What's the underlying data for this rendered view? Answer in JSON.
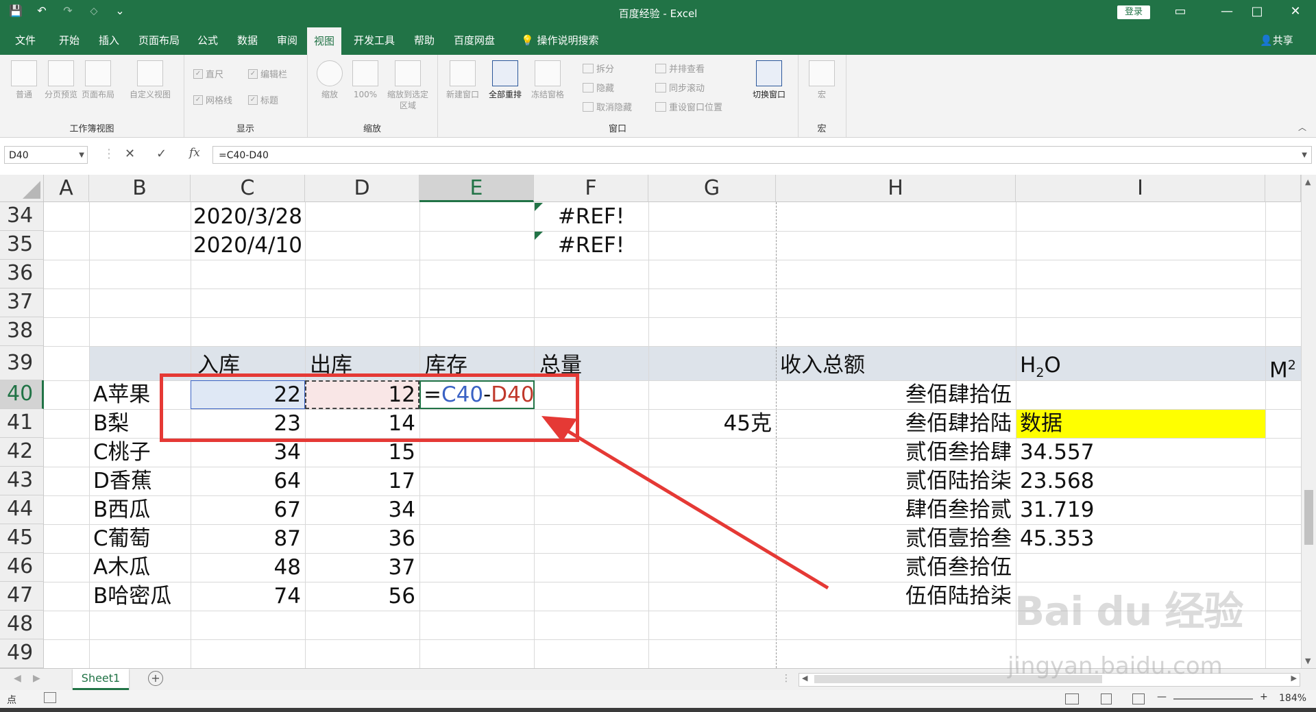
{
  "window": {
    "title": "百度经验  -  Excel",
    "login": "登录",
    "controls": [
      "▭",
      "—",
      "□",
      "✕"
    ]
  },
  "qat": [
    "💾",
    "↶",
    "↷",
    "⬦",
    "⌄"
  ],
  "menu": {
    "tabs": [
      "文件",
      "开始",
      "插入",
      "页面布局",
      "公式",
      "数据",
      "审阅",
      "视图",
      "开发工具",
      "帮助",
      "百度网盘",
      "操作说明搜索"
    ],
    "active": "视图",
    "share": "共享"
  },
  "ribbon": {
    "workbook_views": {
      "label": "工作簿视图",
      "buttons": [
        "普通",
        "分页预览",
        "页面布局",
        "自定义视图"
      ]
    },
    "show": {
      "label": "显示",
      "checks": [
        "直尺",
        "编辑栏",
        "网格线",
        "标题"
      ]
    },
    "zoom": {
      "label": "缩放",
      "buttons": [
        "缩放",
        "100%",
        "缩放到选定区域"
      ]
    },
    "window": {
      "label": "窗口",
      "buttons": [
        "新建窗口",
        "全部重排",
        "冻结窗格"
      ],
      "small": [
        "拆分",
        "隐藏",
        "取消隐藏",
        "并排查看",
        "同步滚动",
        "重设窗口位置"
      ],
      "switch": "切换窗口"
    },
    "macro": {
      "label": "宏",
      "button": "宏"
    }
  },
  "formula_bar": {
    "name_box": "D40",
    "cancel": "✕",
    "enter": "✓",
    "fx": "fx",
    "formula": "=C40-D40"
  },
  "grid": {
    "columns": [
      "A",
      "B",
      "C",
      "D",
      "E",
      "F",
      "G",
      "H",
      "I"
    ],
    "rows": [
      "34",
      "35",
      "36",
      "37",
      "38",
      "39",
      "40",
      "41",
      "42",
      "43",
      "44",
      "45",
      "46",
      "47",
      "48",
      "49"
    ],
    "cells": {
      "C34": "2020/3/28",
      "C35": "2020/4/10",
      "F34": "#REF!",
      "F35": "#REF!",
      "C39": "入库",
      "D39": "出库",
      "E39": "库存",
      "F39": "总量",
      "H39": "收入总额",
      "I39_main": "H",
      "I39_sub": "2",
      "I39_end": "O",
      "J39_main": "M",
      "J39_sup": "2",
      "E40_eq": "=",
      "E40_c": "C40",
      "E40_minus": "-",
      "E40_d": "D40",
      "G41": "45克",
      "I41": "数据",
      "H40": "叁佰肆拾伍",
      "H41": "叁佰肆拾陆",
      "H42": "贰佰叁拾肆",
      "H43": "贰佰陆拾柒",
      "H44": "肆佰叁拾贰",
      "H45": "贰佰壹拾叁",
      "H46": "贰佰叁拾伍",
      "H47": "伍佰陆拾柒",
      "I42": "34.557",
      "I43": "23.568",
      "I44": "31.719",
      "I45": "45.353"
    },
    "products": [
      {
        "name": "A苹果",
        "in": "22",
        "out": "12"
      },
      {
        "name": "B梨",
        "in": "23",
        "out": "14"
      },
      {
        "name": "C桃子",
        "in": "34",
        "out": "15"
      },
      {
        "name": "D香蕉",
        "in": "64",
        "out": "17"
      },
      {
        "name": "B西瓜",
        "in": "67",
        "out": "34"
      },
      {
        "name": "C葡萄",
        "in": "87",
        "out": "36"
      },
      {
        "name": "A木瓜",
        "in": "48",
        "out": "37"
      },
      {
        "name": "B哈密瓜",
        "in": "74",
        "out": "56"
      }
    ]
  },
  "sheets": {
    "nav": [
      "◀",
      "▶"
    ],
    "active": "Sheet1",
    "add": "+"
  },
  "status": {
    "mode": "点",
    "zoom_minus": "—",
    "zoom_plus": "+",
    "zoom": "184%"
  },
  "watermark": {
    "logo": "Bai du 经验",
    "url": "jingyan.baidu.com"
  },
  "colors": {
    "excel_green": "#217346",
    "highlight_yellow": "#ffff00",
    "annotation_red": "#e53935",
    "ref_blue": "#3a62c4",
    "ref_red": "#c0392b"
  }
}
